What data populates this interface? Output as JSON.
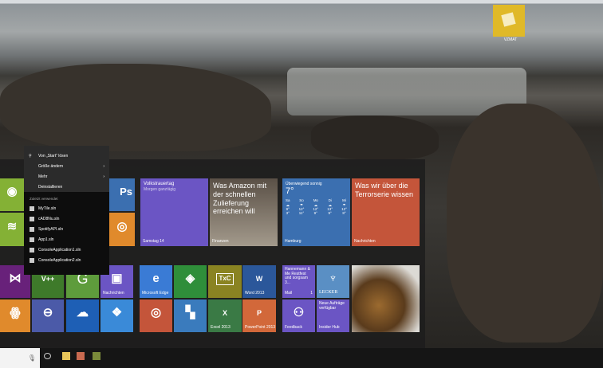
{
  "desktop": {
    "icon_label": "VZMAT"
  },
  "context_menu": {
    "items": [
      {
        "label": "Von „Start“ lösen"
      },
      {
        "label": "Größe ändern",
        "submenu": true
      },
      {
        "label": "Mehr",
        "submenu": true
      },
      {
        "label": "Deinstallieren"
      }
    ],
    "recent_header": "Zuletzt verwendet",
    "recent": [
      "MyTile.sln",
      "cAD8Nu.sln",
      "SpotifyAPI.sln",
      "App1.sln",
      "ConsoleApplication1.sln",
      "ConsoleApplication2.sln"
    ],
    "chevron": "›"
  },
  "tiles": {
    "calendar": {
      "title": "Volkstrauertag",
      "subtitle": "Morgen ganztägig",
      "label": "Samstag 14",
      "color": "#6b55c4"
    },
    "finance": {
      "title": "Was Amazon mit der schnellen Zulieferung erreichen will",
      "label": "Finanzen"
    },
    "weather": {
      "title": "Überwiegend sonnig",
      "temp": "7°",
      "days": [
        "Sa",
        "So",
        "Mo",
        "Di",
        "Mi"
      ],
      "highs": [
        "9°",
        "12°",
        "12°",
        "13°",
        "12°"
      ],
      "lows": [
        "3°",
        "11°",
        "9°",
        "9°",
        "8°"
      ],
      "label": "Hamburg",
      "color": "#3b6fb0"
    },
    "news": {
      "title": "Was wir über die Terrorserie wissen",
      "label": "Nachrichten",
      "color": "#c4553a"
    },
    "ps": "Ps",
    "nachrichten": "Nachrichten",
    "edge": "Microsoft Edge",
    "word": "Word 2013",
    "excel": "Excel 2013",
    "powerpoint": "PowerPoint 2013",
    "mail": {
      "text": "Hannemann & Me Restfest und sorgsam 3...",
      "label": "Mail",
      "count": "1"
    },
    "lecker": "LECKER",
    "lecker_sub": "Neue Aufträge verfügbar",
    "insider": "Insider Hub",
    "feedback": "Feedback",
    "vpp": "V++",
    "g": "G",
    "txc": "TxC",
    "e": "e"
  }
}
